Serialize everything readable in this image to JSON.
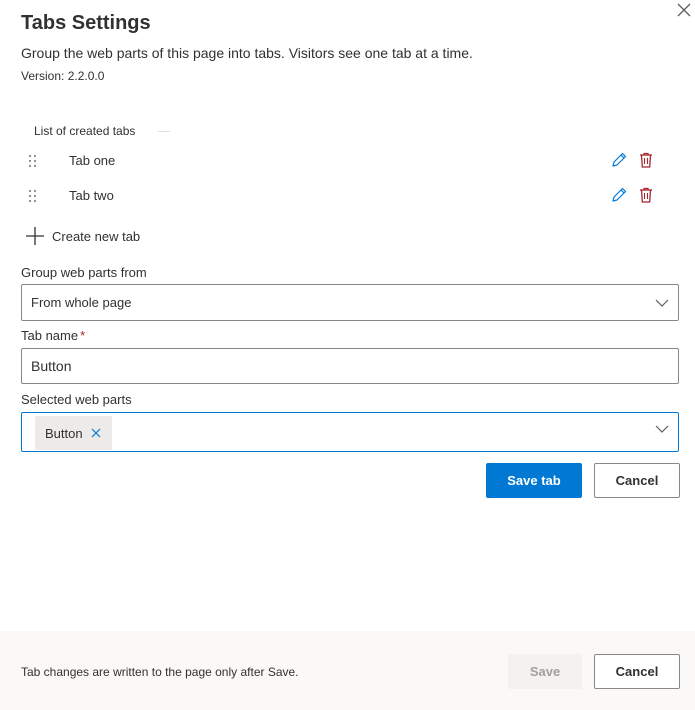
{
  "panel": {
    "title": "Tabs Settings",
    "description": "Group the web parts of this page into tabs. Visitors see one tab at a time.",
    "version": "Version: 2.2.0.0",
    "close_icon": "close-icon"
  },
  "tabs_list": {
    "label": "List of created tabs",
    "items": [
      {
        "label": "Tab one",
        "drag_icon": "gripper-icon",
        "edit_icon": "pencil-icon",
        "delete_icon": "trash-icon"
      },
      {
        "label": "Tab two",
        "drag_icon": "gripper-icon",
        "edit_icon": "pencil-icon",
        "delete_icon": "trash-icon"
      }
    ],
    "create_label": "Create new tab",
    "create_icon": "plus-icon"
  },
  "form": {
    "group_label": "Group web parts from",
    "group_value": "From whole page",
    "tab_name_label": "Tab name",
    "tab_name_required": "*",
    "tab_name_value": "Button",
    "selected_label": "Selected web parts",
    "selected_chips": [
      "Button"
    ],
    "save_tab_label": "Save tab",
    "cancel_label": "Cancel"
  },
  "footer": {
    "note": "Tab changes are written to the page only after Save.",
    "save_label": "Save",
    "cancel_label": "Cancel"
  },
  "colors": {
    "accent": "#0078d4",
    "delete": "#a4262c",
    "edit": "#0078d4",
    "text": "#323130",
    "border": "#8a8886",
    "footer_bg": "#faf9f8"
  }
}
